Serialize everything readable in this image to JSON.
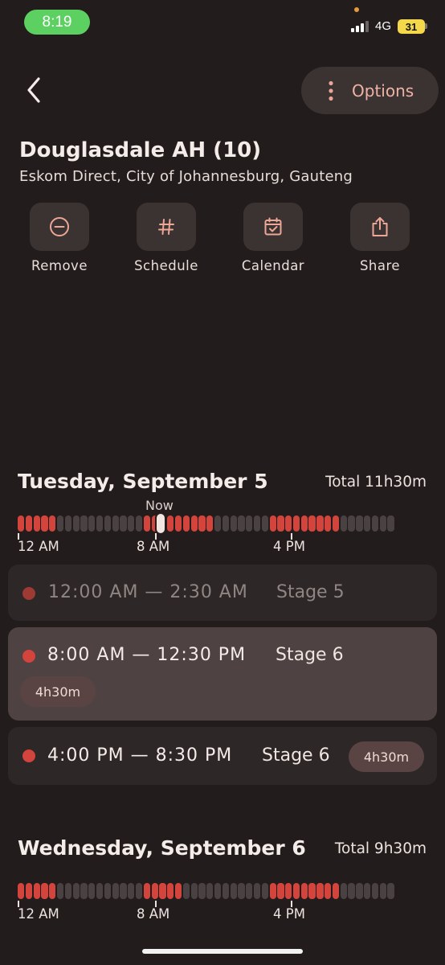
{
  "status_bar": {
    "time": "8:19",
    "network": "4G",
    "battery": "31"
  },
  "header": {
    "options_label": "Options"
  },
  "location": {
    "title": "Douglasdale AH (10)",
    "subtitle": "Eskom Direct, City of Johannesburg, Gauteng"
  },
  "actions": [
    {
      "label": "Remove",
      "icon": "minus-circle-icon"
    },
    {
      "label": "Schedule",
      "icon": "hash-icon"
    },
    {
      "label": "Calendar",
      "icon": "calendar-check-icon"
    },
    {
      "label": "Share",
      "icon": "share-icon"
    }
  ],
  "days": [
    {
      "title": "Tuesday, September 5",
      "total": "Total 11h30m",
      "now_label": "Now",
      "timeline": [
        1,
        1,
        1,
        1,
        1,
        0,
        0,
        0,
        0,
        0,
        0,
        0,
        0,
        0,
        0,
        0,
        1,
        1,
        1,
        1,
        1,
        1,
        1,
        1,
        1,
        0,
        0,
        0,
        0,
        0,
        0,
        0,
        1,
        1,
        1,
        1,
        1,
        1,
        1,
        1,
        1,
        0,
        0,
        0,
        0,
        0,
        0,
        0
      ],
      "tick_labels": [
        "12 AM",
        "8 AM",
        "4 PM"
      ],
      "slots": [
        {
          "range": "12:00 AM — 2:30 AM",
          "stage": "Stage 5"
        },
        {
          "range": "8:00 AM — 12:30 PM",
          "stage": "Stage 6",
          "duration": "4h30m"
        },
        {
          "range": "4:00 PM — 8:30 PM",
          "stage": "Stage 6",
          "duration": "4h30m"
        }
      ]
    },
    {
      "title": "Wednesday, September 6",
      "total": "Total 9h30m",
      "timeline": [
        1,
        1,
        1,
        1,
        1,
        0,
        0,
        0,
        0,
        0,
        0,
        0,
        0,
        0,
        0,
        0,
        1,
        1,
        1,
        1,
        1,
        0,
        0,
        0,
        0,
        0,
        0,
        0,
        0,
        0,
        0,
        0,
        1,
        1,
        1,
        1,
        1,
        1,
        1,
        1,
        1,
        0,
        0,
        0,
        0,
        0,
        0,
        0
      ],
      "tick_labels": [
        "12 AM",
        "8 AM",
        "4 PM"
      ]
    }
  ],
  "colors": {
    "accent": "#d2443c",
    "background": "#221c1c",
    "card": "#2e2727",
    "status_green": "#5dd062"
  }
}
